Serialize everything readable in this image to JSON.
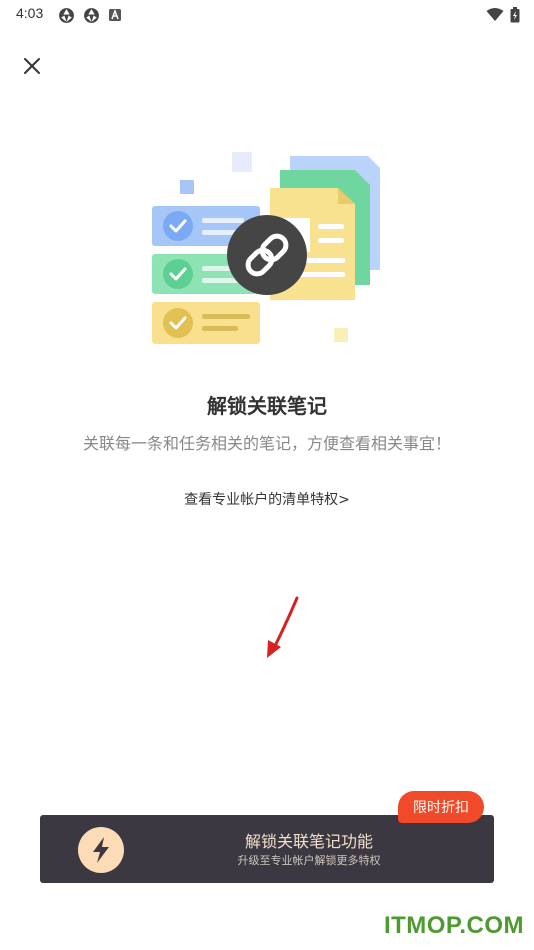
{
  "status_bar": {
    "time": "4:03",
    "left_icons": [
      "aperture-icon",
      "aperture-icon",
      "a-icon"
    ],
    "right_icons": [
      "wifi-icon",
      "battery-icon"
    ]
  },
  "header": {
    "close_icon": "close-icon"
  },
  "content": {
    "title": "解锁关联笔记",
    "subtitle": "关联每一条和任务相关的笔记，方便查看相关事宜！",
    "link_text": "查看专业帐户的清单特权>"
  },
  "banner": {
    "title": "解锁关联笔记功能",
    "subtitle": "升级至专业帐户解锁更多特权",
    "icon": "lightning-icon",
    "badge": "限时折扣"
  },
  "watermark": "ITMOP.COM",
  "colors": {
    "banner_bg": "#3b3842",
    "badge_bg": "#f04a2b",
    "accent_gold": "#fcdcb6",
    "blue": "#79a9f5",
    "green": "#63d39a",
    "yellow": "#f8e08e",
    "link_circle": "#444444"
  }
}
